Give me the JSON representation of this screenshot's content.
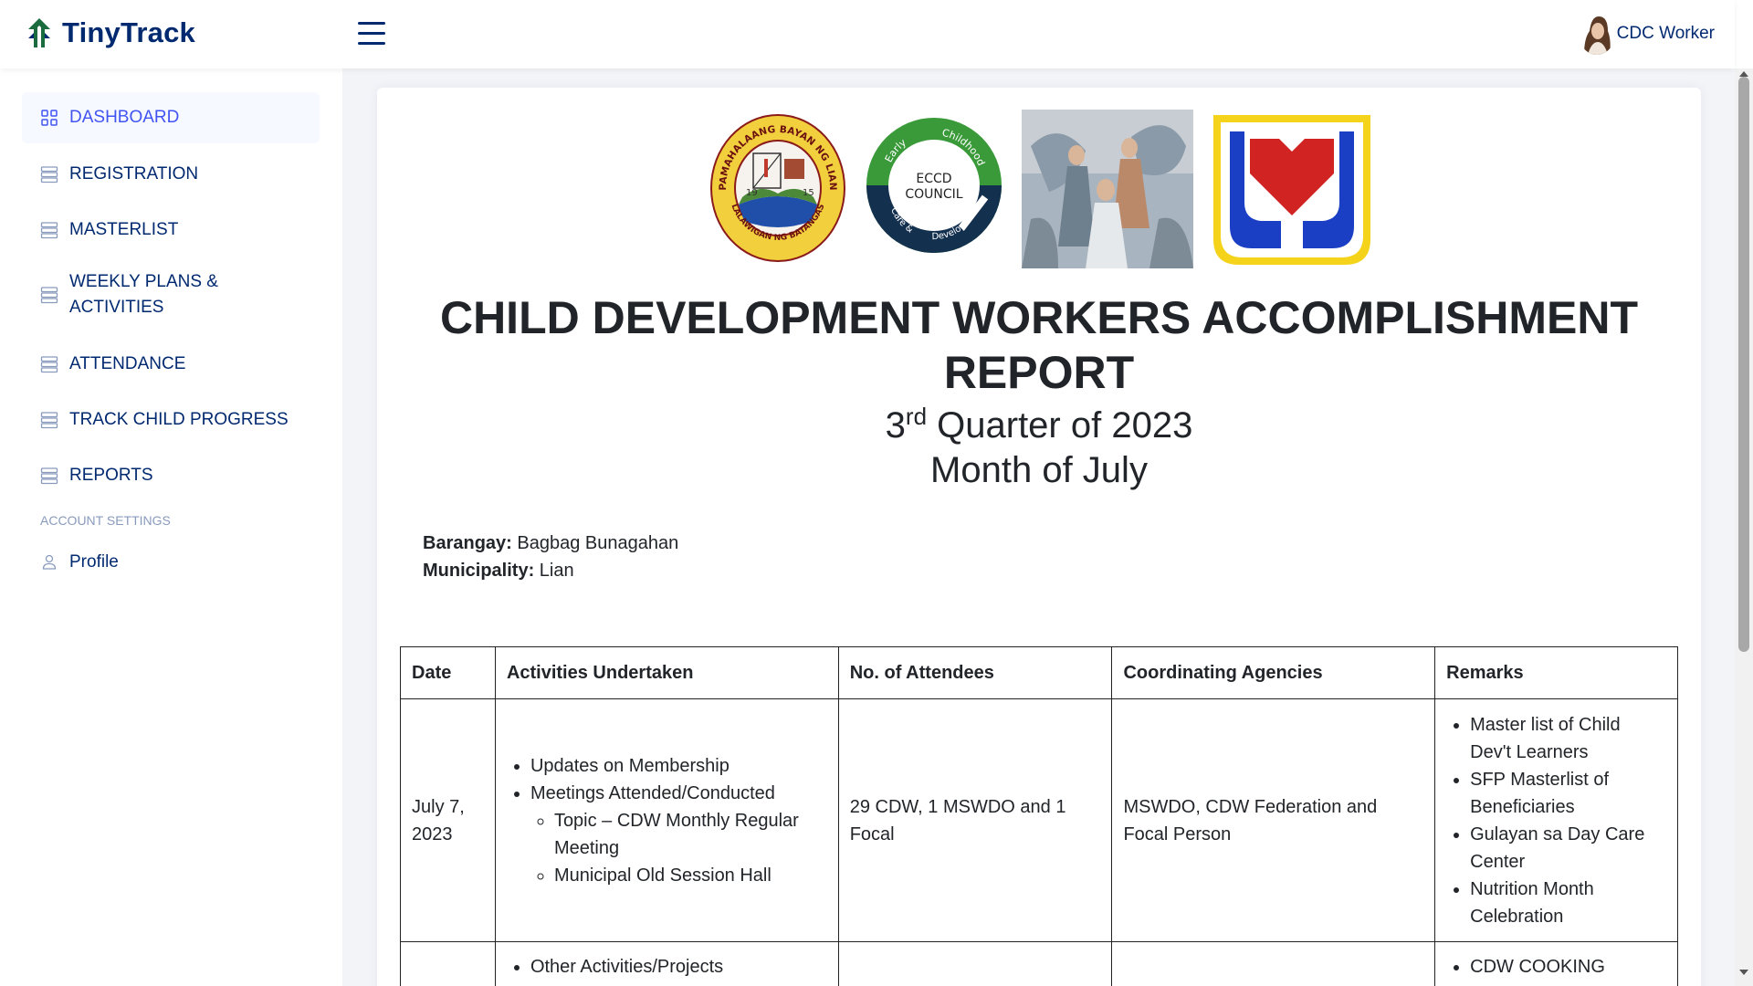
{
  "app": {
    "name": "TinyTrack"
  },
  "header": {
    "user_name": "CDC Worker"
  },
  "sidebar": {
    "items": [
      {
        "label": "DASHBOARD",
        "active": true
      },
      {
        "label": "REGISTRATION"
      },
      {
        "label": "MASTERLIST"
      },
      {
        "label": "WEEKLY PLANS & ACTIVITIES"
      },
      {
        "label": "ATTENDANCE"
      },
      {
        "label": "TRACK CHILD PROGRESS"
      },
      {
        "label": "REPORTS"
      }
    ],
    "section_heading": "ACCOUNT SETTINGS",
    "profile_label": "Profile"
  },
  "logos": {
    "seal_text_top": "PAMAHALAANG BAYAN NG LIAN",
    "seal_text_bottom": "LALAWIGAN NG BATANGAS",
    "seal_year_left": "19",
    "seal_year_right": "15",
    "eccd_line1": "ECCD",
    "eccd_line2": "COUNCIL",
    "eccd_arc_1": "Early",
    "eccd_arc_2": "Childhood",
    "eccd_arc_3": "Care &",
    "eccd_arc_4": "Development"
  },
  "report": {
    "title": "CHILD DEVELOPMENT WORKERS ACCOMPLISHMENT REPORT",
    "quarter_num": "3",
    "quarter_suffix": "rd",
    "quarter_rest": " Quarter of 2023",
    "month": "Month of July",
    "barangay_label": "Barangay:",
    "barangay_value": " Bagbag Bunagahan",
    "municipality_label": "Municipality:",
    "municipality_value": " Lian"
  },
  "table": {
    "headers": [
      "Date",
      "Activities Undertaken",
      "No. of Attendees",
      "Coordinating Agencies",
      "Remarks"
    ],
    "row1": {
      "date": "July 7, 2023",
      "activity_1": "Updates on Membership",
      "activity_2": "Meetings Attended/Conducted",
      "sub_1": "Topic – CDW Monthly Regular Meeting",
      "sub_2": "Municipal Old Session Hall",
      "attendees": "29 CDW, 1 MSWDO and 1 Focal",
      "agencies": "MSWDO, CDW Federation and Focal Person",
      "remark_1": "Master list of Child Dev't Learners",
      "remark_2": "SFP Masterlist of Beneficiaries",
      "remark_3": "Gulayan sa Day Care Center",
      "remark_4": "Nutrition Month Celebration"
    },
    "row2": {
      "activity_1": "Other Activities/Projects",
      "remark_1": "CDW COOKING"
    }
  },
  "colors": {
    "primary": "#012970",
    "active": "#4154f1",
    "muted": "#899bbd"
  }
}
